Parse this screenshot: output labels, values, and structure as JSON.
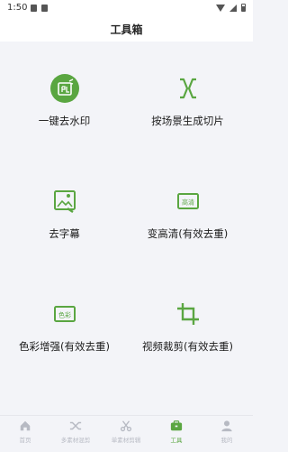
{
  "status_bar": {
    "time": "1:50"
  },
  "header": {
    "title": "工具箱"
  },
  "tools": [
    {
      "label": "一键去水印",
      "icon": "remove-watermark-icon"
    },
    {
      "label": "按场景生成切片",
      "icon": "scene-slice-icon"
    },
    {
      "label": "去字幕",
      "icon": "remove-subtitle-icon"
    },
    {
      "label": "变高清(有效去重)",
      "icon": "hd-icon",
      "icon_text": "高清"
    },
    {
      "label": "色彩增强(有效去重)",
      "icon": "color-enhance-icon",
      "icon_text": "色彩"
    },
    {
      "label": "视频裁剪(有效去重)",
      "icon": "crop-icon"
    }
  ],
  "tabbar": [
    {
      "label": "首页",
      "icon": "home-icon",
      "active": false
    },
    {
      "label": "多素材混剪",
      "icon": "shuffle-icon",
      "active": false
    },
    {
      "label": "单素材剪辑",
      "icon": "scissors-icon",
      "active": false
    },
    {
      "label": "工具",
      "icon": "toolbox-icon",
      "active": true
    },
    {
      "label": "我的",
      "icon": "profile-icon",
      "active": false
    }
  ],
  "colors": {
    "accent": "#5aa641",
    "inactive": "#b7bac3",
    "background": "#f3f4f8"
  }
}
